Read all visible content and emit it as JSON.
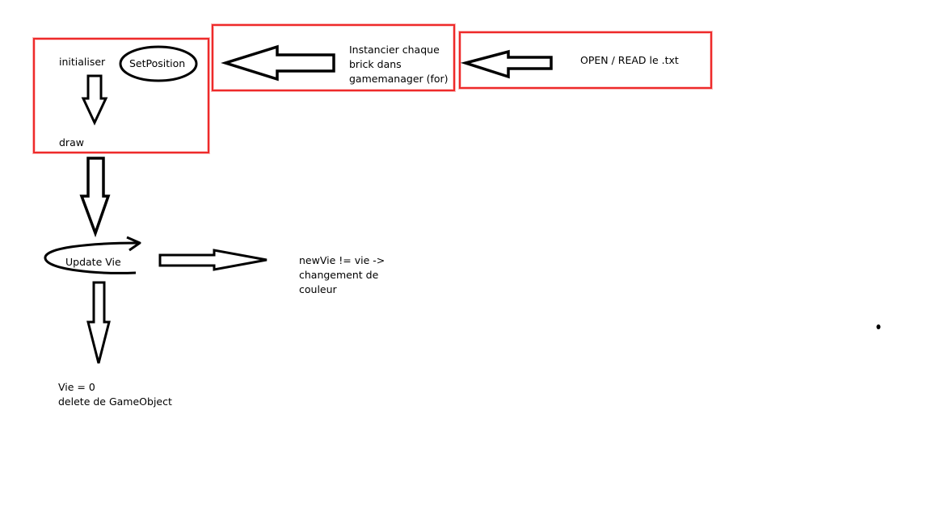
{
  "diagram": {
    "boxes": {
      "object_box": {
        "initialise_label": "initialiser",
        "set_position_label": "SetPosition",
        "draw_label": "draw"
      },
      "instancier_box": {
        "lines": [
          "Instancier chaque",
          "brick dans",
          "gamemanager (for)"
        ]
      },
      "open_box": {
        "label": "OPEN / READ le .txt"
      }
    },
    "update_vie_label": "Update Vie",
    "change_color_lines": [
      "newVie != vie ->",
      "changement de",
      "couleur"
    ],
    "delete_lines": [
      "Vie = 0",
      "delete de GameObject"
    ],
    "colors": {
      "box_border": "#ee2a2a",
      "stroke": "#000000",
      "background": "#ffffff"
    }
  }
}
